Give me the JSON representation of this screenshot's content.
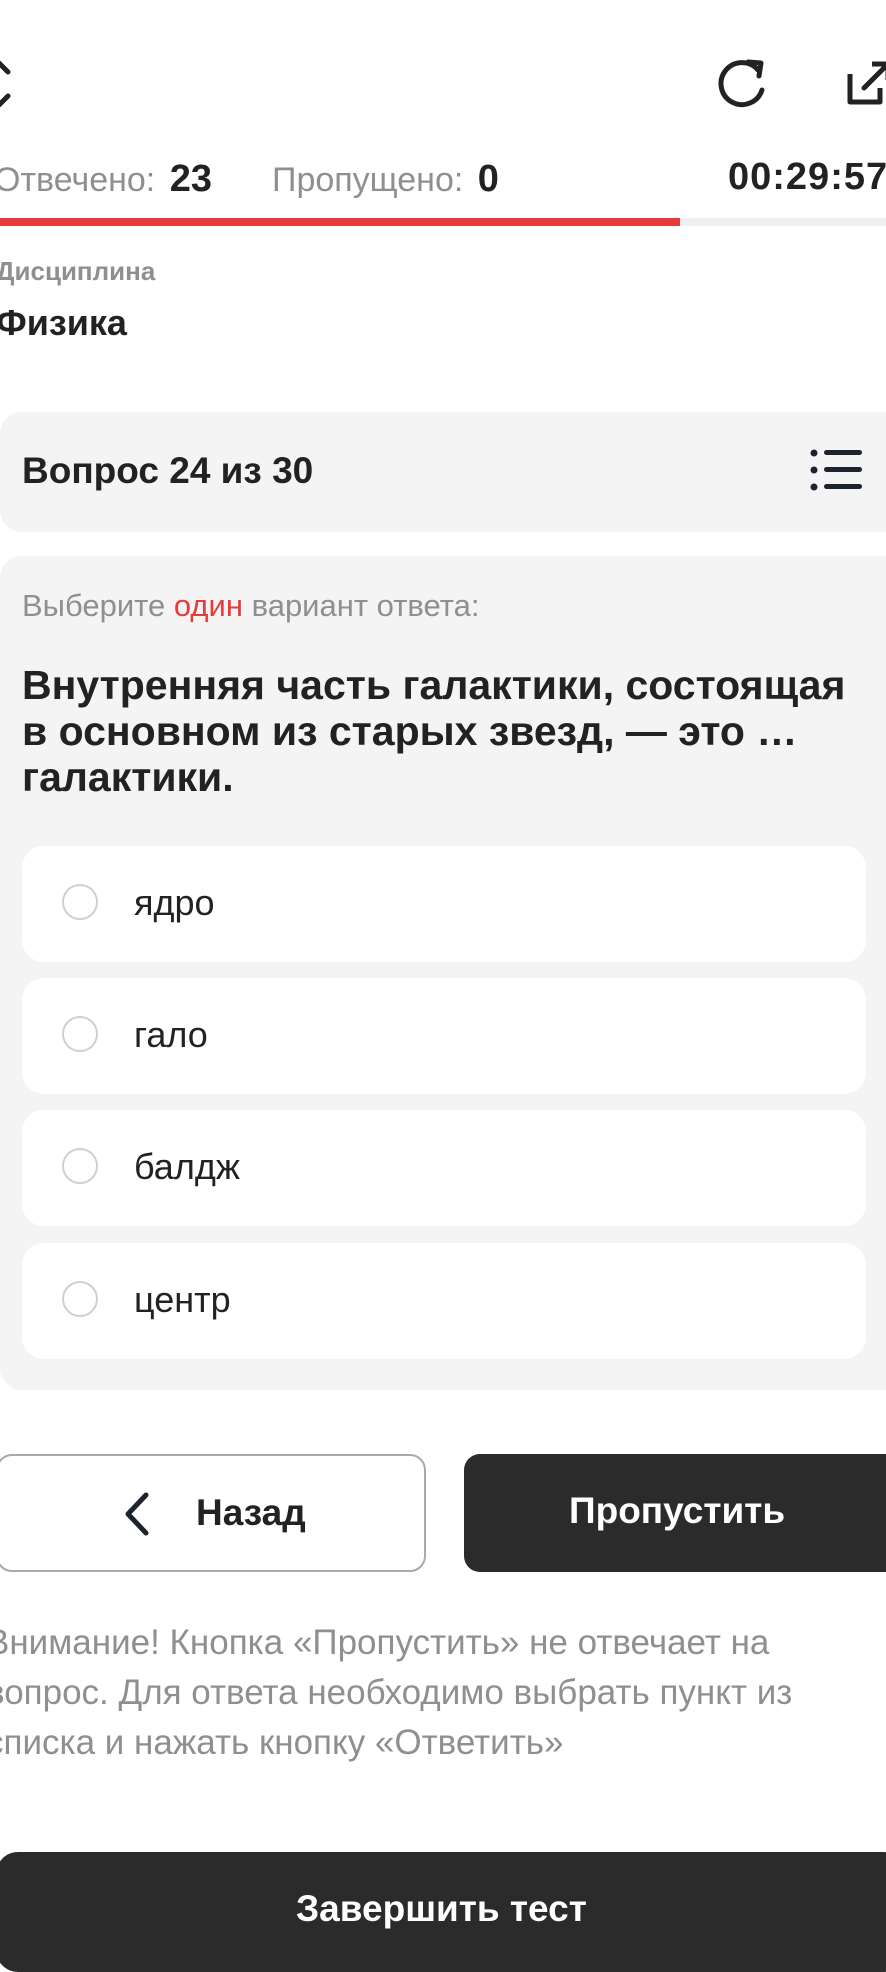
{
  "stats": {
    "answered_label": "Отвечено:",
    "answered_value": "23",
    "skipped_label": "Пропущено:",
    "skipped_value": "0",
    "timer": "00:29:57"
  },
  "progress": {
    "fraction": 0.767
  },
  "discipline": {
    "label": "Дисциплина",
    "value": "Физика"
  },
  "question": {
    "counter": "Вопрос 24 из 30",
    "instruction_before": "Выберите ",
    "instruction_accent": "один",
    "instruction_after": " вариант ответа:",
    "text": "Внутренняя часть галактики, состоящая в основном из старых звезд, — это … галактики.",
    "options": [
      {
        "label": "ядро"
      },
      {
        "label": "гало"
      },
      {
        "label": "балдж"
      },
      {
        "label": "центр"
      }
    ]
  },
  "buttons": {
    "back": "Назад",
    "skip": "Пропустить",
    "finish": "Завершить тест"
  },
  "warning": "Внимание! Кнопка «Пропустить» не отвечает на вопрос. Для ответа необходимо выбрать пункт из списка и нажать кнопку «Ответить»",
  "colors": {
    "accent": "#e63b3b",
    "dark_button": "#2b2b2b",
    "panel": "#f4f4f4",
    "muted_text": "#8f8f8f"
  },
  "icons": {
    "back": "close-icon",
    "reload": "reload-icon",
    "external": "external-link-icon",
    "list": "list-icon",
    "chevron": "chevron-left-icon"
  }
}
